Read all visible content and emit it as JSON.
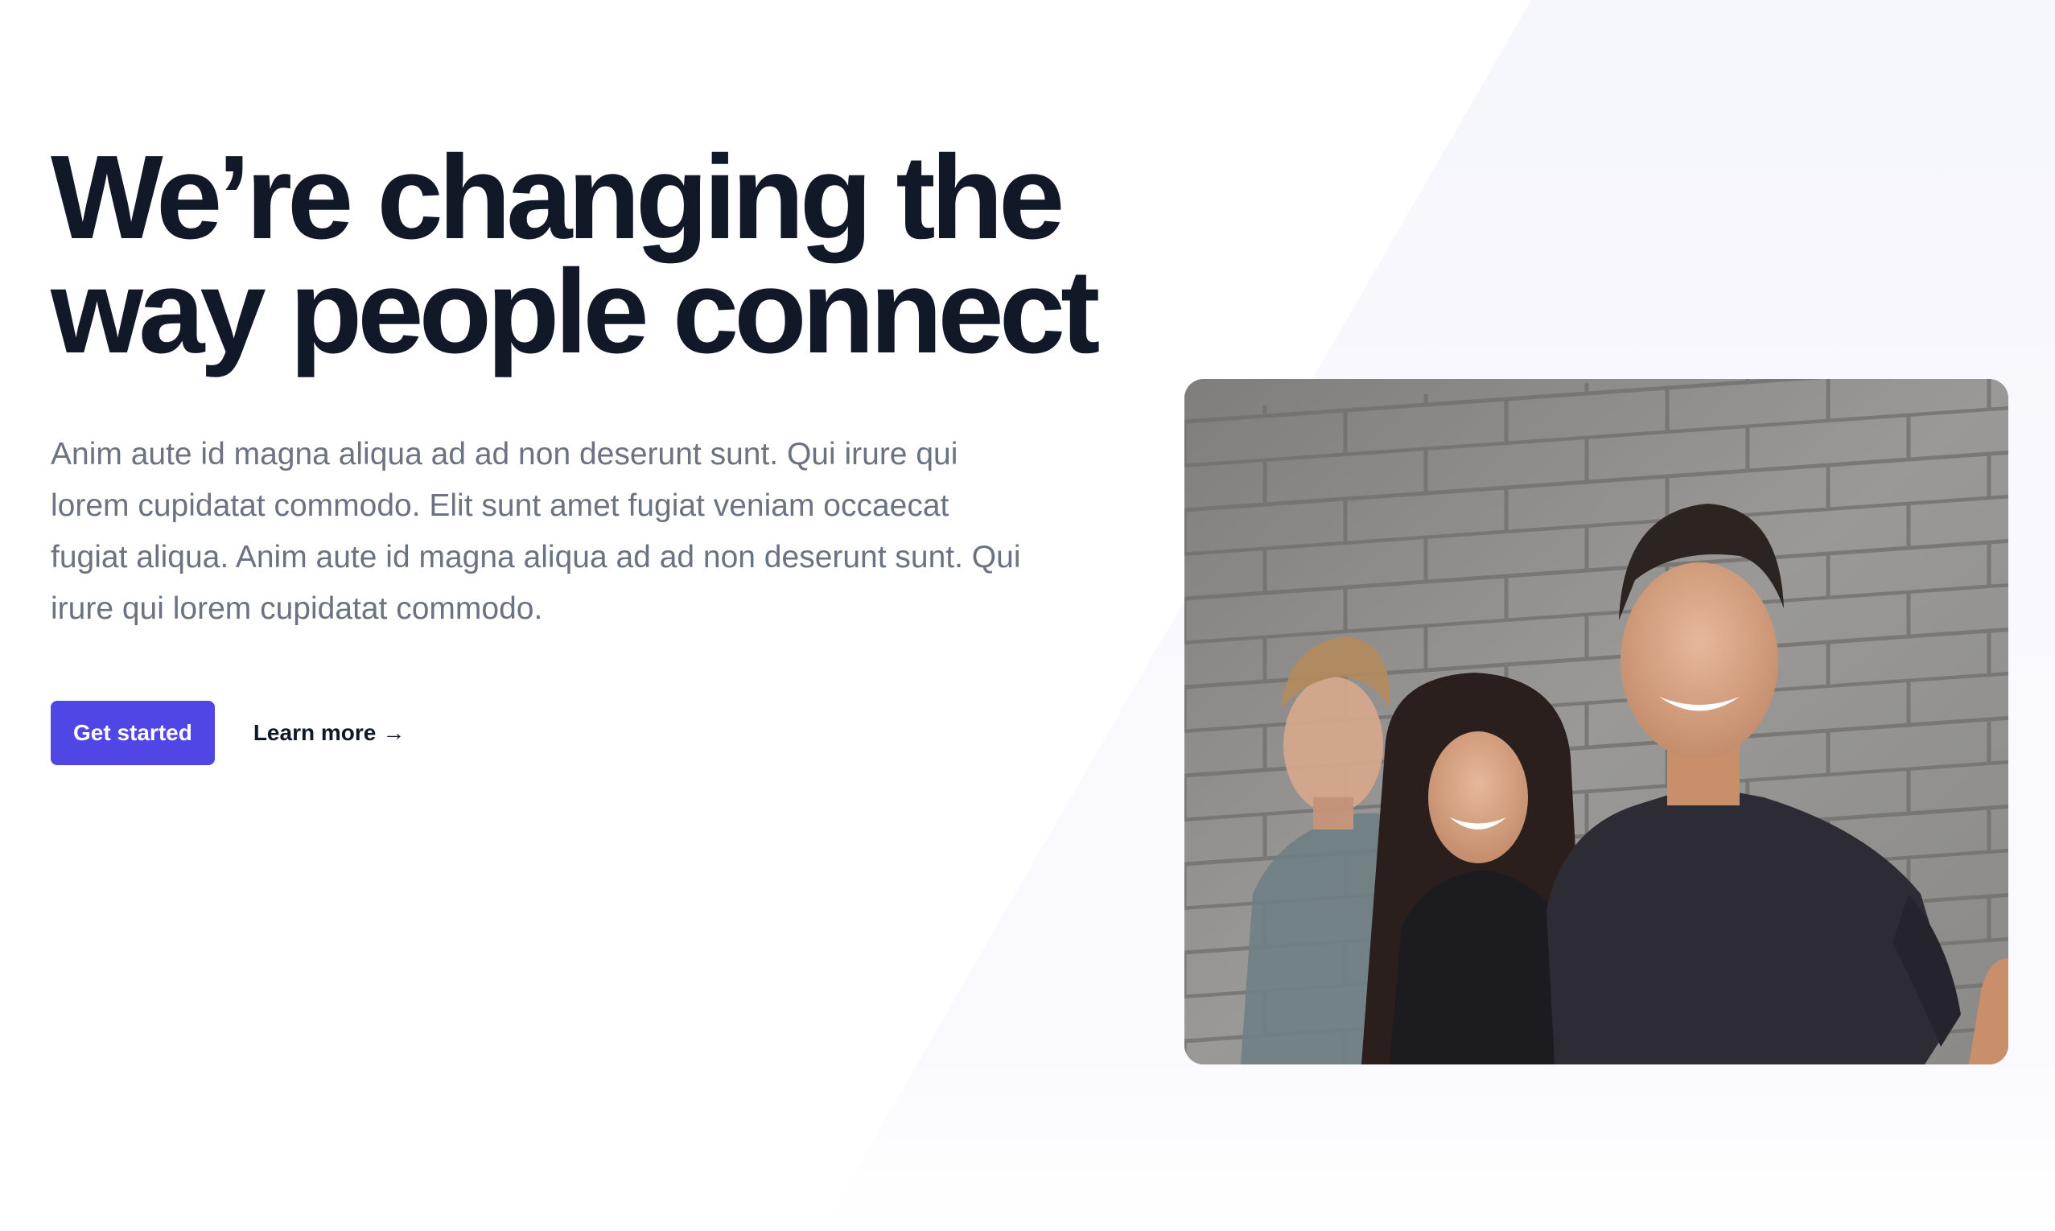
{
  "hero": {
    "headline_line1": "We’re changing the",
    "headline_line2": "way people connect",
    "description": "Anim aute id magna aliqua ad ad non deserunt sunt. Qui irure qui lorem cupidatat commodo. Elit sunt amet fugiat veniam occaecat fugiat aliqua. Anim aute id magna aliqua ad ad non deserunt sunt. Qui irure qui lorem cupidatat commodo.",
    "primary_button_label": "Get started",
    "secondary_link_label": "Learn more",
    "secondary_link_arrow": "→",
    "photo_alt": "Three smiling people standing in front of a grey concrete block wall"
  },
  "colors": {
    "accent": "#4f46e5",
    "heading": "#111827",
    "body_text": "#6b7280",
    "slant_background": "#f7f7fc"
  },
  "icons": {
    "arrow": "arrow-right-icon"
  }
}
